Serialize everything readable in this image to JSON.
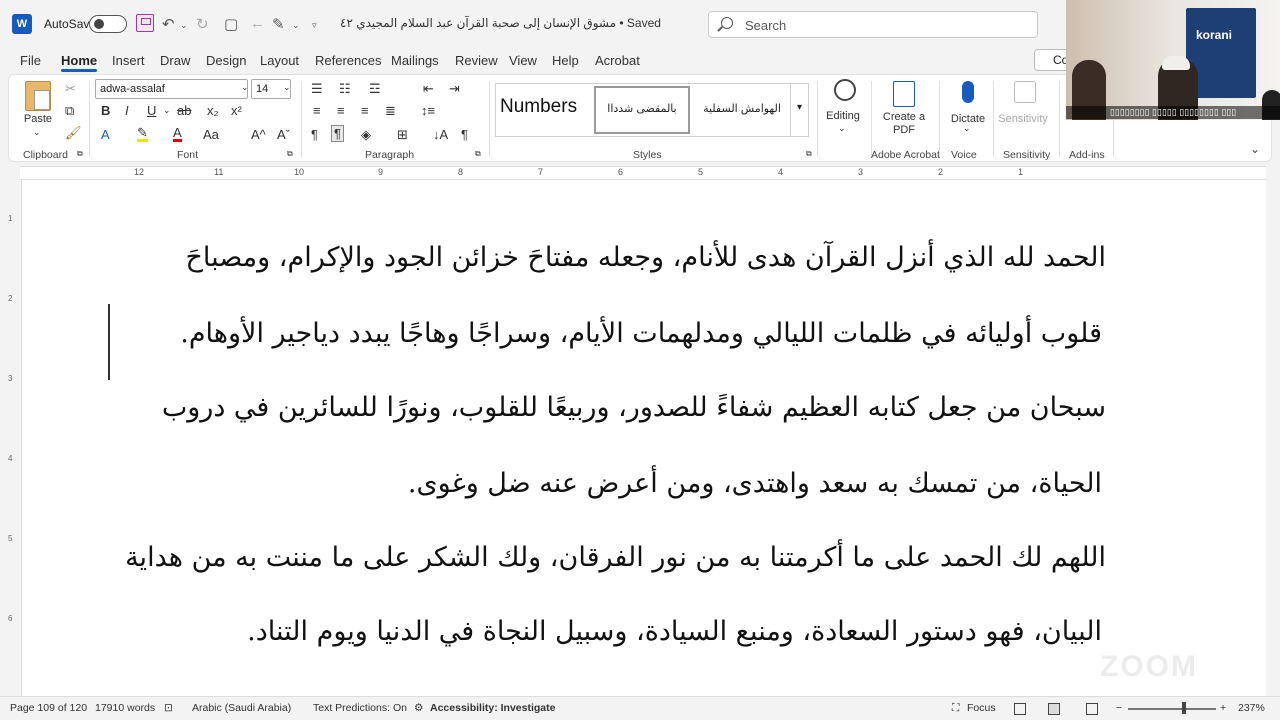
{
  "titlebar": {
    "app_logo": "W",
    "autosave_label": "AutoSave",
    "autosave_state": "Off",
    "doc_title": "مشوق الإنسان إلى صحبة القرآن عبد السلام المجيدي ٤٢ • Saved",
    "search_placeholder": "Search"
  },
  "menu": {
    "tabs": [
      "File",
      "Home",
      "Insert",
      "Draw",
      "Design",
      "Layout",
      "References",
      "Mailings",
      "Review",
      "View",
      "Help",
      "Acrobat"
    ],
    "active_tab": "Home",
    "comments_label": "Co"
  },
  "ribbon": {
    "paste_label": "Paste",
    "font_name": "adwa-assalaf",
    "font_size": "14",
    "styles": [
      "Numbers",
      "بالمقضى شدداا",
      "الهوامش السفلية"
    ],
    "editing_label": "Editing",
    "create_pdf_label": "Create a PDF",
    "dictate_label": "Dictate",
    "sensitivity_label": "Sensitivity",
    "groups": {
      "clipboard": "Clipboard",
      "font": "Font",
      "paragraph": "Paragraph",
      "styles": "Styles",
      "acrobat": "Adobe Acrobat",
      "voice": "Voice",
      "sensitivity": "Sensitivity",
      "addins": "Add-ins"
    }
  },
  "ruler": {
    "marks": [
      "12",
      "11",
      "10",
      "9",
      "8",
      "7",
      "6",
      "5",
      "4",
      "3",
      "2",
      "1"
    ],
    "vmarks": [
      "1",
      "2",
      "3",
      "4",
      "5",
      "6"
    ]
  },
  "document": {
    "lines": [
      "الحمد لله الذي أنزل القرآن هدى للأنام، وجعله مفتاحَ خزائن الجود والإكرام، ومصباحَ",
      "قلوب أوليائه في ظلمات الليالي ومدلهمات الأيام، وسراجًا وهاجًا يبدد دياجير الأوهام.",
      "سبحان من جعل كتابه العظيم شفاءً للصدور، وربيعًا للقلوب، ونورًا للسائرين في دروب",
      "الحياة، من تمسك به سعد واهتدى، ومن أعرض عنه ضل وغوى.",
      "اللهم لك الحمد على ما أكرمتنا به من نور الفرقان، ولك الشكر على ما مننت به من هداية",
      "البيان، فهو دستور السعادة، ومنبع السيادة، وسبيل النجاة في الدنيا ويوم التناد."
    ]
  },
  "statusbar": {
    "page": "Page 109 of 120",
    "words": "17910 words",
    "language": "Arabic (Saudi Arabia)",
    "predictions": "Text Predictions: On",
    "accessibility": "Accessibility: Investigate",
    "focus": "Focus",
    "zoom": "237%",
    "zoom_level_percent": 237
  },
  "video": {
    "banner_text": "korani",
    "caption": "▯▯▯▯▯▯▯▯ ▯▯▯▯▯ ▯▯▯▯▯▯▯▯ ▯▯▯"
  },
  "watermark": "ZOOM"
}
